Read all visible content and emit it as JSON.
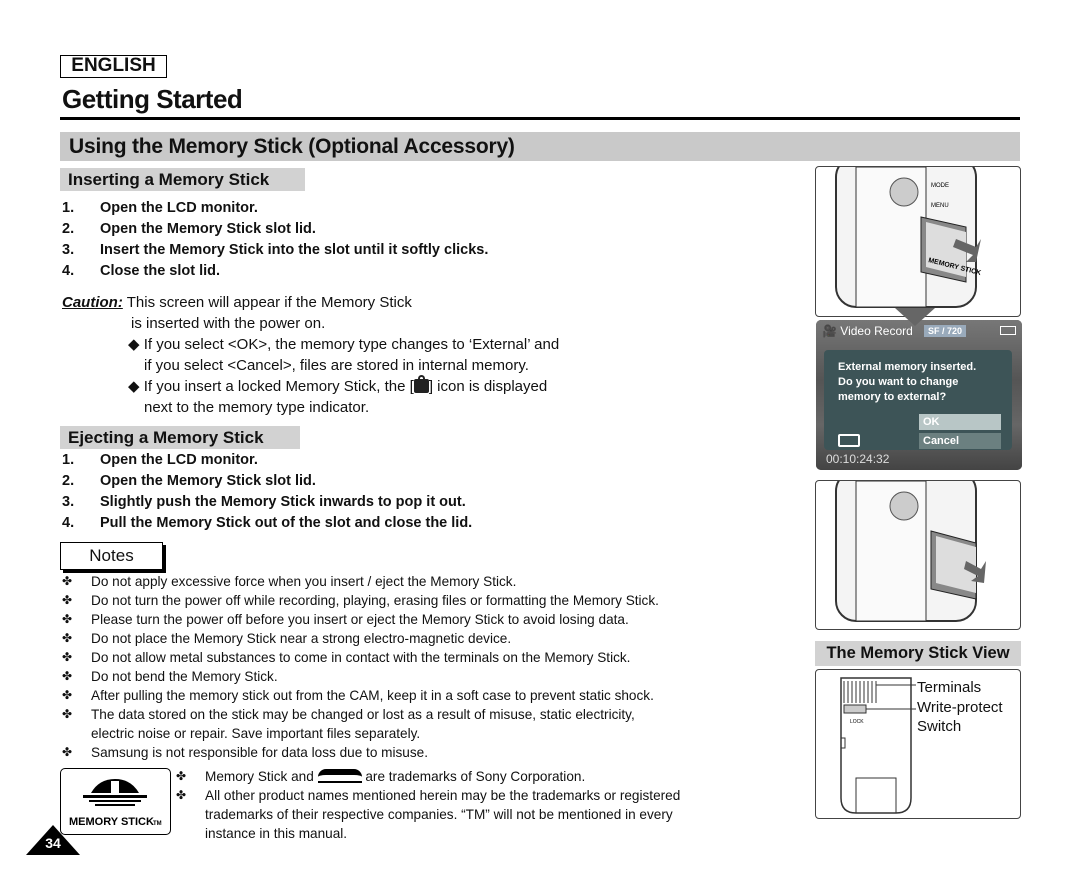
{
  "header": {
    "language": "ENGLISH",
    "chapter": "Getting Started"
  },
  "section_title": "Using the Memory Stick (Optional Accessory)",
  "inserting": {
    "heading": "Inserting a Memory Stick",
    "steps": [
      {
        "n": "1.",
        "text": "Open the LCD monitor."
      },
      {
        "n": "2.",
        "text": "Open the Memory Stick slot lid."
      },
      {
        "n": "3.",
        "text": "Insert the Memory Stick into the slot until it softly clicks."
      },
      {
        "n": "4.",
        "text": "Close the slot lid."
      }
    ]
  },
  "caution": {
    "label": "Caution:",
    "line1": "This screen will appear if the Memory Stick",
    "line2": "is inserted with the power on.",
    "bullet1a": "◆ If you select <OK>, the memory type changes to ‘External’ and",
    "bullet1b": "if you select <Cancel>, files are stored in internal memory.",
    "bullet2a": "◆ If you insert a locked Memory Stick, the [",
    "bullet2b": "] icon is displayed",
    "bullet2c": "next to the memory type indicator."
  },
  "ejecting": {
    "heading": "Ejecting a Memory Stick",
    "steps": [
      {
        "n": "1.",
        "text": "Open the LCD monitor."
      },
      {
        "n": "2.",
        "text": "Open the Memory Stick slot lid."
      },
      {
        "n": "3.",
        "text": "Slightly push the Memory Stick inwards to pop it out."
      },
      {
        "n": "4.",
        "text": "Pull the Memory Stick out of the slot and close the lid."
      }
    ]
  },
  "notes": {
    "label": "Notes",
    "bullet": "✤",
    "items": [
      "Do not apply excessive force when you insert / eject the Memory Stick.",
      "Do not turn the power off while recording, playing, erasing files or formatting the Memory Stick.",
      "Please turn the power off before you insert or eject the Memory Stick to avoid losing data.",
      "Do not place the Memory Stick near a strong electro-magnetic device.",
      "Do not allow metal substances to come in contact with the terminals on the Memory Stick.",
      "Do not bend the Memory Stick.",
      "After pulling the memory stick out from the CAM, keep it in a soft case to prevent static shock.",
      "The data stored on the stick may be changed or lost as a result of misuse, static electricity,",
      "electric noise or repair. Save important files separately.",
      "Samsung is not responsible for data loss due to misuse."
    ]
  },
  "trademarks": {
    "line1a": "Memory Stick and",
    "line1b": "are trademarks of Sony Corporation.",
    "line2": "All other product names mentioned herein may be the trademarks or registered",
    "line3": "trademarks of their respective companies. “TM” will not be mentioned in every",
    "line4": "instance in this manual.",
    "logo_text": "MEMORY STICK TM"
  },
  "page_number": "34",
  "lcd": {
    "mode": "Video Record",
    "quality": "SF / 720",
    "message1": "External memory inserted.",
    "message2": "Do you want to change",
    "message3": "memory to external?",
    "ok": "OK",
    "cancel": "Cancel",
    "counter": "00:10:24:32"
  },
  "stick_view": {
    "heading": "The Memory Stick View",
    "labels": [
      "Terminals",
      "Write-protect",
      "Switch"
    ],
    "lock_label": "LOCK"
  },
  "camera_labels": {
    "brand_on_stick": "MEMORY STICK",
    "mode": "MODE",
    "menu": "MENU"
  }
}
